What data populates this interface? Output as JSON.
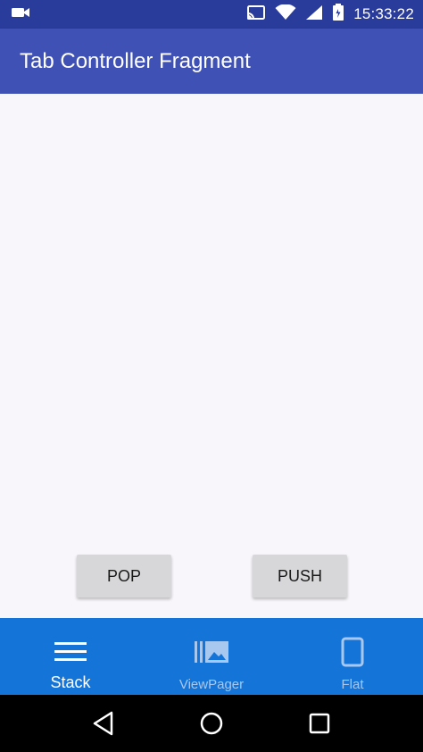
{
  "status_bar": {
    "time": "15:33:22",
    "icons": [
      "video-camera-icon",
      "cast-icon",
      "wifi-icon",
      "signal-icon",
      "battery-icon"
    ]
  },
  "app_bar": {
    "title": "Tab Controller Fragment",
    "color": "#3f51b5"
  },
  "content": {
    "pop_label": "POP",
    "push_label": "PUSH"
  },
  "bottom_nav": {
    "color": "#1474d8",
    "items": [
      {
        "label": "Stack",
        "icon": "menu-lines-icon",
        "active": true
      },
      {
        "label": "ViewPager",
        "icon": "gallery-icon",
        "active": false
      },
      {
        "label": "Flat",
        "icon": "phone-outline-icon",
        "active": false
      }
    ]
  },
  "system_nav": {
    "icons": [
      "back-icon",
      "home-icon",
      "recents-icon"
    ]
  }
}
